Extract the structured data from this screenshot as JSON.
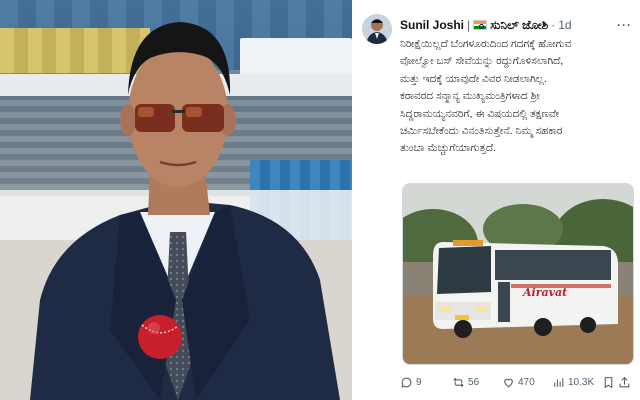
{
  "tweet": {
    "display_name": "Sunil Joshi",
    "separator": "|",
    "kannada_name": "ಸುನಿಲ್ ಜೋಶಿ",
    "dot": "·",
    "time": "1d",
    "more": "···",
    "lines": [
      "ನಿರೀಕ್ಷೆಯಿಲ್ಲದೆ ಬೆಂಗಳೂರುದಿಂದ ಗದಗಕ್ಕೆ ಹೋಗುವ",
      "ವೋಲ್ವೋ ಬಸ್ ಸೇವೆಯನ್ನು ರದ್ದುಗೊಳಿಸಲಾಗಿದೆ,",
      "ಮತ್ತು ಇದಕ್ಕೆ ಯಾವುದೇ ವಿವರ ನೀಡಲಾಗಿಲ್ಲ.",
      "ಕರಾವರದ ಸನ್ಮಾನ್ಯ ಮುಖ್ಯಮಂತ್ರಿಗಳಾದ ಶ್ರೀ",
      "ಸಿದ್ದರಾಮಯ್ಯನವರಿಗೆ, ಈ ವಿಷಯದಲ್ಲಿ ತಕ್ಷಣವೇ",
      "ಚರ್ಮಿಸಬೇಕೆಂದು ವಿನಂತಿಸುತ್ತೇನೆ. ನಿಮ್ಮ ಸಹಕಾರ",
      "ತುಂಬಾ ಮೆಚ್ಚುಗೆಯಾಗುತ್ತದೆ."
    ],
    "bus_label": "Airavat",
    "metrics": {
      "replies": "9",
      "reposts": "56",
      "likes": "470",
      "views": "10.3K"
    }
  },
  "icons": {
    "reply": "reply-icon",
    "repost": "repost-icon",
    "like": "heart-icon",
    "views": "views-icon",
    "bookmark": "bookmark-icon",
    "share": "share-icon",
    "more": "more-icon",
    "flag": "india-flag-icon"
  },
  "colors": {
    "text": "#0f1419",
    "muted": "#536471",
    "suit": "#1f2b44",
    "ball": "#c81f2a"
  }
}
